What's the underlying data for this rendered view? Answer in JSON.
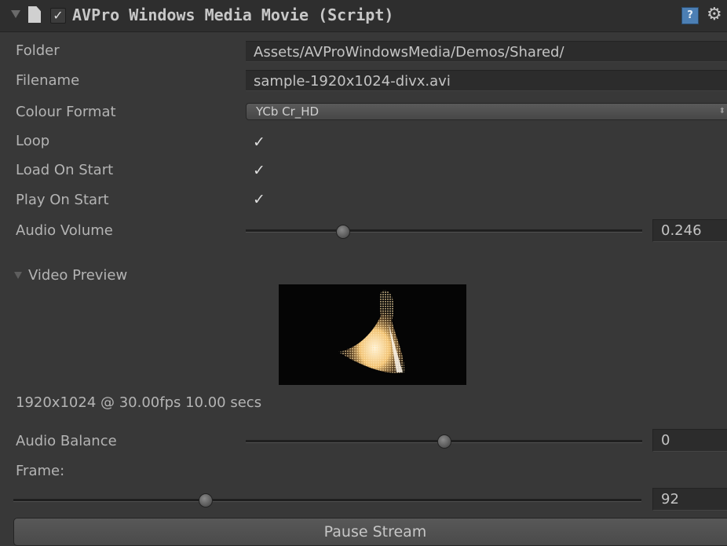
{
  "header": {
    "title": "AVPro Windows Media Movie (Script)",
    "enabled_check": "✓",
    "help_glyph": "?",
    "gear_glyph": "⚙"
  },
  "fields": {
    "folder": {
      "label": "Folder",
      "value": "Assets/AVProWindowsMedia/Demos/Shared/"
    },
    "filename": {
      "label": "Filename",
      "value": "sample-1920x1024-divx.avi"
    },
    "colour_format": {
      "label": "Colour Format",
      "value": "YCb Cr_HD",
      "arrows": "⬍"
    },
    "loop": {
      "label": "Loop",
      "checked": true,
      "glyph": "✓"
    },
    "load_on_start": {
      "label": "Load On Start",
      "checked": true,
      "glyph": "✓"
    },
    "play_on_start": {
      "label": "Play On Start",
      "checked": true,
      "glyph": "✓"
    },
    "audio_volume": {
      "label": "Audio Volume",
      "value": "0.246",
      "slider_fraction": 0.246
    }
  },
  "video_preview": {
    "label": "Video Preview",
    "info": "1920x1024 @ 30.00fps 10.00 secs"
  },
  "audio_balance": {
    "label": "Audio Balance",
    "value": "0",
    "min": -1,
    "max": 1
  },
  "frame": {
    "label": "Frame:",
    "value": "92",
    "total_frames": 300
  },
  "pause_button": {
    "label": "Pause Stream"
  },
  "colors": {
    "background": "#383838",
    "header": "#2e2e2e",
    "field": "#2c2c2c",
    "text": "#b4b4b4"
  }
}
